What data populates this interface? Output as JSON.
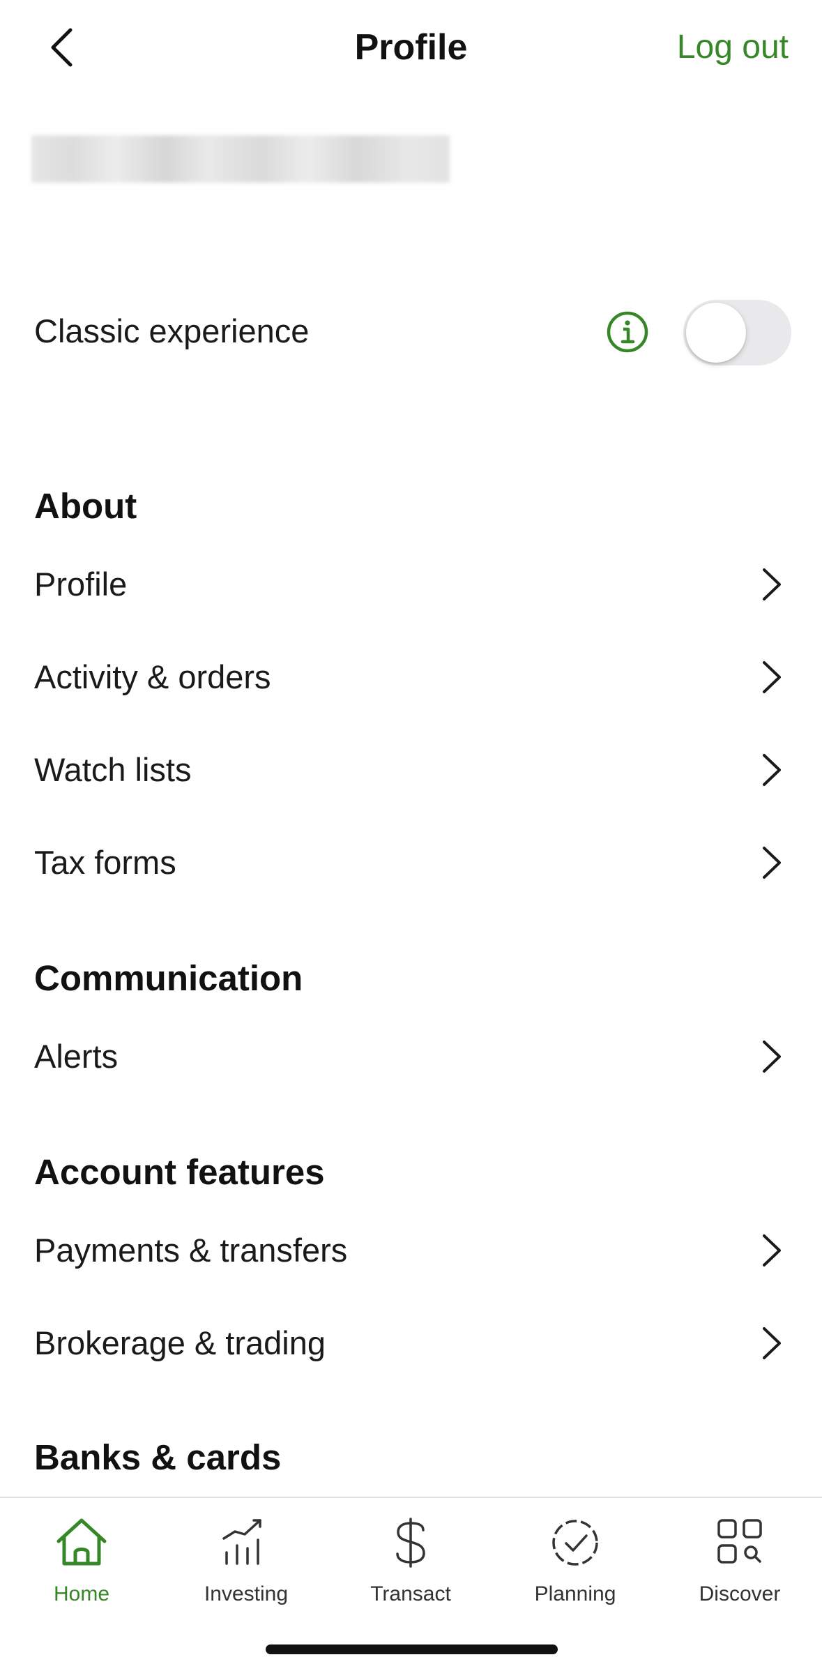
{
  "header": {
    "title": "Profile",
    "logout_label": "Log out"
  },
  "classic": {
    "label": "Classic experience",
    "toggle_on": false
  },
  "sections": [
    {
      "heading": "About",
      "items": [
        {
          "label": "Profile"
        },
        {
          "label": "Activity & orders"
        },
        {
          "label": "Watch lists"
        },
        {
          "label": "Tax forms"
        }
      ]
    },
    {
      "heading": "Communication",
      "items": [
        {
          "label": "Alerts"
        }
      ]
    },
    {
      "heading": "Account features",
      "items": [
        {
          "label": "Payments & transfers"
        },
        {
          "label": "Brokerage & trading"
        }
      ]
    },
    {
      "heading": "Banks & cards",
      "items": []
    }
  ],
  "tabbar": {
    "tabs": [
      {
        "label": "Home",
        "icon": "home-icon",
        "active": true
      },
      {
        "label": "Investing",
        "icon": "investing-chart-icon",
        "active": false
      },
      {
        "label": "Transact",
        "icon": "dollar-icon",
        "active": false
      },
      {
        "label": "Planning",
        "icon": "planning-check-icon",
        "active": false
      },
      {
        "label": "Discover",
        "icon": "discover-grid-icon",
        "active": false
      }
    ]
  },
  "colors": {
    "accent": "#368727",
    "text": "#1a1a1a",
    "toggle_off": "#e9e9eb"
  }
}
